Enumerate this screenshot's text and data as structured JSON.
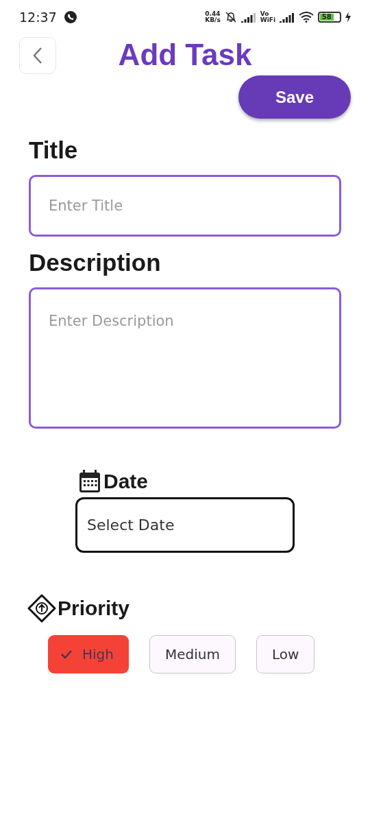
{
  "status_bar": {
    "time": "12:37",
    "speed": "0.44",
    "speed_unit": "KB/s",
    "volte": "Vo",
    "volte_sub": "WiFi",
    "battery": "58"
  },
  "header": {
    "title": "Add Task",
    "save": "Save"
  },
  "fields": [
    {
      "label": "Title",
      "placeholder": "Enter Title",
      "kind": "single"
    },
    {
      "label": "Description",
      "placeholder": "Enter Description",
      "kind": "multi"
    }
  ],
  "date": {
    "label": "Date",
    "value": "Select Date"
  },
  "priority": {
    "label": "Priority",
    "options": [
      {
        "label": "High",
        "selected": true
      },
      {
        "label": "Medium",
        "selected": false
      },
      {
        "label": "Low",
        "selected": false
      }
    ]
  }
}
